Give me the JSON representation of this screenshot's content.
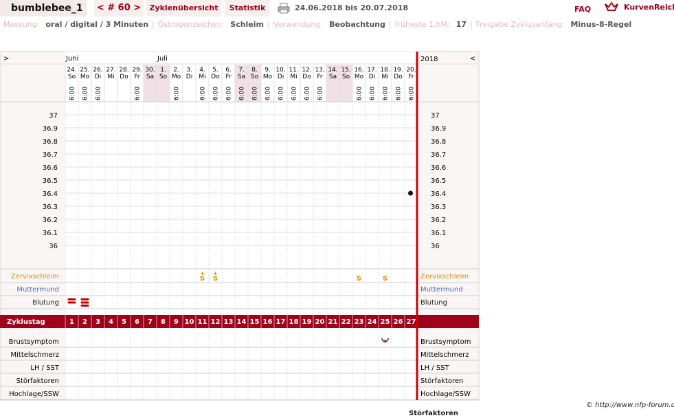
{
  "header": {
    "username": "bumblebee_1",
    "cycle_nav": "< # 60 >",
    "tab_overview": "Zyklenübersicht",
    "tab_stats": "Statistik",
    "print_icon": "printer-icon",
    "date_range": "24.06.2018 bis 20.07.2018",
    "faq": "FAQ",
    "brand": "KurvenReich",
    "brand_icon": "crown-logo-icon"
  },
  "info": [
    {
      "label": "Messung:",
      "value": "oral / digital / 3 Minuten"
    },
    {
      "label": "Östrogenzeichen:",
      "value": "Schleim"
    },
    {
      "label": "Verwendung:",
      "value": "Beobachtung"
    },
    {
      "label": "früheste 1.hM:",
      "value": "17"
    },
    {
      "label": "Freigabe Zyklusanfang:",
      "value": "Minus-8-Regel"
    }
  ],
  "colors": {
    "accent": "#a0001a",
    "cervix": "#e08a00",
    "mumu": "#4a6cc0",
    "weekend": "#f1e1e6",
    "grid": "#ddd"
  },
  "chart_data": {
    "type": "line",
    "nav_left": ">",
    "nav_right": "<",
    "year": "2018",
    "months": [
      {
        "index": 0,
        "label": "Juni"
      },
      {
        "index": 7,
        "label": "Juli"
      }
    ],
    "days": [
      {
        "date": "24.",
        "wd": "So",
        "time": "6:00"
      },
      {
        "date": "25.",
        "wd": "Mo",
        "time": "6:00"
      },
      {
        "date": "26.",
        "wd": "Di",
        "time": "6:00"
      },
      {
        "date": "27.",
        "wd": "Mi",
        "time": ""
      },
      {
        "date": "28.",
        "wd": "Do",
        "time": ""
      },
      {
        "date": "29.",
        "wd": "Fr",
        "time": "6:00"
      },
      {
        "date": "30.",
        "wd": "Sa",
        "time": ""
      },
      {
        "date": "1.",
        "wd": "So",
        "time": ""
      },
      {
        "date": "2.",
        "wd": "Mo",
        "time": "6:00"
      },
      {
        "date": "3.",
        "wd": "Di",
        "time": ""
      },
      {
        "date": "4.",
        "wd": "Mi",
        "time": "6:00"
      },
      {
        "date": "5.",
        "wd": "Do",
        "time": "6:00"
      },
      {
        "date": "6.",
        "wd": "Fr",
        "time": "6:00"
      },
      {
        "date": "7.",
        "wd": "Sa",
        "time": "6:00"
      },
      {
        "date": "8.",
        "wd": "So",
        "time": "6:00"
      },
      {
        "date": "9.",
        "wd": "Mo",
        "time": "6:00"
      },
      {
        "date": "10.",
        "wd": "Di",
        "time": "6:00"
      },
      {
        "date": "11.",
        "wd": "Mi",
        "time": "6:00"
      },
      {
        "date": "12.",
        "wd": "Do",
        "time": "6:00"
      },
      {
        "date": "13.",
        "wd": "Fr",
        "time": "6:00"
      },
      {
        "date": "14.",
        "wd": "Sa",
        "time": ""
      },
      {
        "date": "15.",
        "wd": "So",
        "time": ""
      },
      {
        "date": "16.",
        "wd": "Mo",
        "time": "6:00"
      },
      {
        "date": "17.",
        "wd": "Di",
        "time": "6:00"
      },
      {
        "date": "18.",
        "wd": "Mi",
        "time": "6:00"
      },
      {
        "date": "19.",
        "wd": "Do",
        "time": "6:00"
      },
      {
        "date": "20.",
        "wd": "Fr",
        "time": "6:00"
      }
    ],
    "weekend_shaded": [
      6,
      7,
      13,
      14,
      20,
      21
    ],
    "ylim": [
      36,
      37
    ],
    "yticks": [
      "37",
      "36.9",
      "36.8",
      "36.7",
      "36.6",
      "36.5",
      "36.4",
      "36.3",
      "36.2",
      "36.1",
      "36"
    ],
    "series": [
      {
        "values": [
          {
            "day": 26,
            "temp": 36.4
          }
        ]
      }
    ],
    "rows_top": [
      {
        "label": "Zervixschleim",
        "color": "#e08a00",
        "marks": [
          {
            "day": 10,
            "symbol": "S+"
          },
          {
            "day": 11,
            "symbol": "S+"
          },
          {
            "day": 22,
            "symbol": "S"
          },
          {
            "day": 24,
            "symbol": "S"
          }
        ]
      },
      {
        "label": "Muttermund",
        "color": "#4a6cc0",
        "marks": []
      },
      {
        "label": "Blutung",
        "color": "#222",
        "marks": [
          {
            "day": 0,
            "symbol": "bleed-medium-icon"
          },
          {
            "day": 1,
            "symbol": "bleed-heavy-icon"
          }
        ]
      }
    ],
    "cycle_day_label": "Zyklustag",
    "cycle_days": [
      "1",
      "2",
      "3",
      "4",
      "5",
      "6",
      "7",
      "8",
      "9",
      "10",
      "11",
      "12",
      "13",
      "14",
      "15",
      "16",
      "17",
      "18",
      "19",
      "20",
      "21",
      "22",
      "23",
      "24",
      "25",
      "26",
      "27"
    ],
    "rows_bottom": [
      {
        "label": "Brustsymptom",
        "marks": [
          {
            "day": 24,
            "symbol": "breast-symptom-icon"
          }
        ]
      },
      {
        "label": "Mittelschmerz",
        "marks": []
      },
      {
        "label": "LH / SST",
        "marks": []
      },
      {
        "label": "Störfaktoren",
        "marks": []
      },
      {
        "label": "Hochlage/SSW",
        "marks": []
      }
    ]
  },
  "footer": {
    "copyright": "© http://www.nfp-forum.de",
    "cutoff": "Störfaktoren"
  }
}
